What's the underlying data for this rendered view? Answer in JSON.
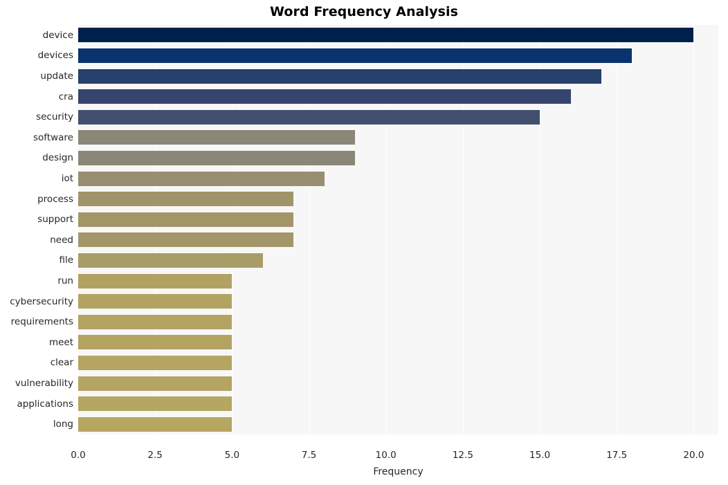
{
  "chart_data": {
    "type": "bar",
    "orientation": "horizontal",
    "title": "Word Frequency Analysis",
    "xlabel": "Frequency",
    "ylabel": "",
    "xlim": [
      0,
      20.8
    ],
    "xticks": [
      "0.0",
      "2.5",
      "5.0",
      "7.5",
      "10.0",
      "12.5",
      "15.0",
      "17.5",
      "20.0"
    ],
    "xtick_values": [
      0,
      2.5,
      5,
      7.5,
      10,
      12.5,
      15,
      17.5,
      20
    ],
    "grid": true,
    "legend": null,
    "categories": [
      "device",
      "devices",
      "update",
      "cra",
      "security",
      "software",
      "design",
      "iot",
      "process",
      "support",
      "need",
      "file",
      "run",
      "cybersecurity",
      "requirements",
      "meet",
      "clear",
      "vulnerability",
      "applications",
      "long"
    ],
    "values": [
      20,
      18,
      17,
      16,
      15,
      9,
      9,
      8,
      7,
      7,
      7,
      6,
      5,
      5,
      5,
      5,
      5,
      5,
      5,
      5
    ],
    "colors": [
      "#00204c",
      "#0a326e",
      "#27406c",
      "#36456e",
      "#434f6f",
      "#8b8678",
      "#8a8678",
      "#988f70",
      "#a09469",
      "#a29669",
      "#a39769",
      "#a99c67",
      "#b1a263",
      "#b2a362",
      "#b3a462",
      "#b3a462",
      "#b4a562",
      "#b4a562",
      "#b5a661",
      "#b5a661"
    ],
    "plot_bg": "#f7f7f7",
    "fig_bg": "#ffffff",
    "grid_color": "#ffffff"
  }
}
